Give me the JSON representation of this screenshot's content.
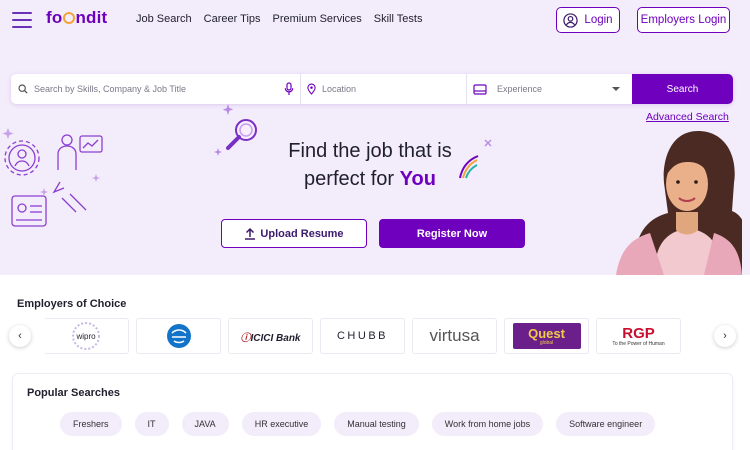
{
  "header": {
    "logo_text_left": "fo",
    "logo_text_right": "ndit",
    "nav": [
      "Job Search",
      "Career Tips",
      "Premium Services",
      "Skill Tests"
    ],
    "login_label": "Login",
    "employers_login_label": "Employers Login"
  },
  "search": {
    "skills_placeholder": "Search by Skills, Company & Job Title",
    "location_placeholder": "Location",
    "experience_placeholder": "Experience",
    "search_button": "Search",
    "advanced_search": "Advanced Search"
  },
  "hero": {
    "headline_line1": "Find the job that is",
    "headline_line2_prefix": "perfect for ",
    "headline_highlight": "You",
    "upload_resume": "Upload Resume",
    "register_now": "Register Now"
  },
  "employers": {
    "title": "Employers of Choice",
    "logos": [
      {
        "name": "wipro",
        "text": "wipro"
      },
      {
        "name": "ntt",
        "text": ""
      },
      {
        "name": "icici",
        "text": "ICICI Bank"
      },
      {
        "name": "chubb",
        "text": "CHUBB"
      },
      {
        "name": "virtusa",
        "text": "virtusa"
      },
      {
        "name": "quest",
        "text": "Quest",
        "sub": "global"
      },
      {
        "name": "rgp",
        "text": "RGP",
        "sub": "To the Power of Human"
      }
    ]
  },
  "popular": {
    "title": "Popular Searches",
    "chips": [
      "Freshers",
      "IT",
      "JAVA",
      "HR executive",
      "Manual testing",
      "Work from home jobs",
      "Software engineer"
    ]
  },
  "colors": {
    "primary": "#6e00be",
    "hero_bg": "#f3ecfb",
    "accent": "#f2a43a"
  },
  "icons": [
    "hamburger-icon",
    "user-icon",
    "search-icon",
    "mic-icon",
    "location-pin-icon",
    "experience-icon",
    "upload-icon",
    "chevron-left-icon",
    "chevron-right-icon"
  ]
}
